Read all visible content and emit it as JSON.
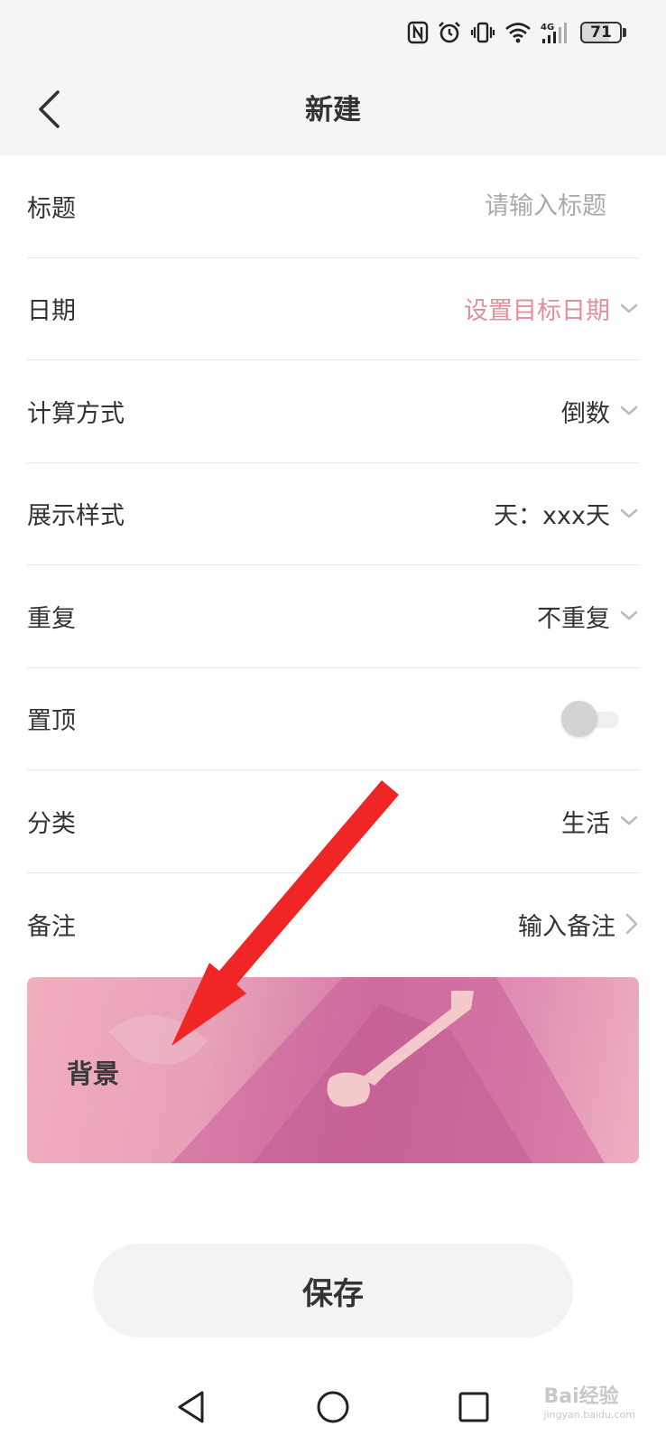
{
  "status_bar": {
    "battery_level": "71",
    "icons": [
      "nfc-icon",
      "alarm-icon",
      "vibrate-icon",
      "wifi-icon",
      "4g-signal-icon",
      "battery-icon"
    ]
  },
  "header": {
    "title": "新建",
    "back_icon": "chevron-left-icon"
  },
  "form": {
    "title_row": {
      "label": "标题",
      "placeholder": "请输入标题"
    },
    "date_row": {
      "label": "日期",
      "value": "设置目标日期"
    },
    "calc_row": {
      "label": "计算方式",
      "value": "倒数"
    },
    "display_row": {
      "label": "展示样式",
      "value": "天：xxx天"
    },
    "repeat_row": {
      "label": "重复",
      "value": "不重复"
    },
    "pin_row": {
      "label": "置顶",
      "enabled": false
    },
    "category_row": {
      "label": "分类",
      "value": "生活"
    },
    "note_row": {
      "label": "备注",
      "value": "输入备注"
    }
  },
  "background_card": {
    "label": "背景"
  },
  "save_button": {
    "label": "保存"
  },
  "nav_bar": {
    "icons": [
      "back-triangle-icon",
      "home-circle-icon",
      "recents-square-icon"
    ]
  },
  "watermark": {
    "text": "Bai经验",
    "sub": "jingyan.baidu.com"
  },
  "colors": {
    "accent": "#e0909a",
    "header_bg": "#f5f5f4",
    "annotation_arrow": "#f02525",
    "button_bg": "#f3f3f2"
  }
}
